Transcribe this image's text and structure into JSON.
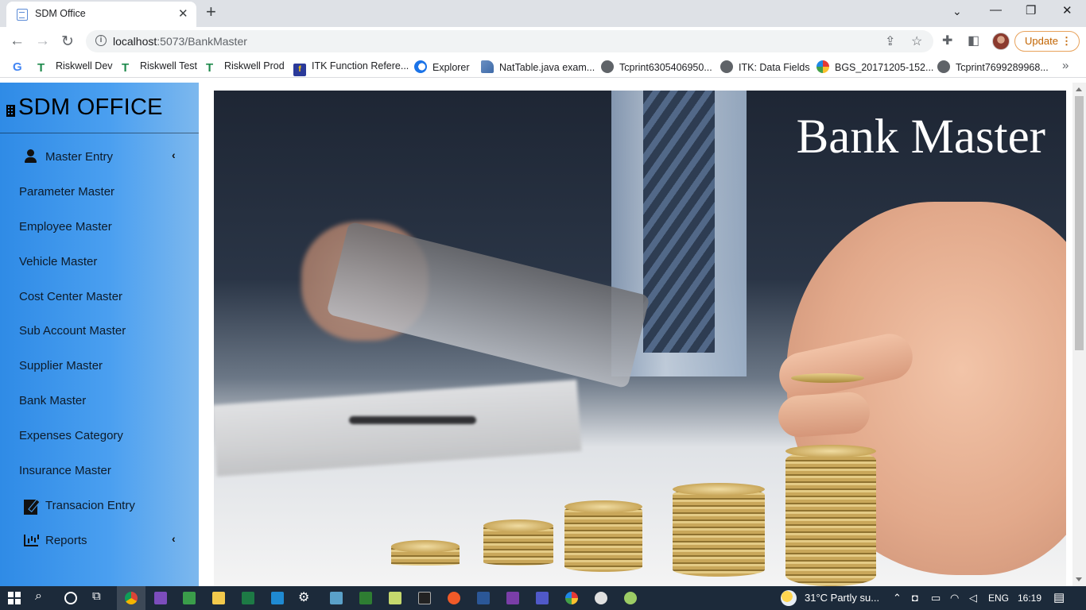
{
  "browser": {
    "tab_title": "SDM Office",
    "tab_close": "✕",
    "new_tab": "+",
    "url_host": "localhost",
    "url_path": ":5073/BankMaster",
    "update_label": "Update",
    "window_controls": {
      "minimize": "—",
      "restore": "❐",
      "close": "✕",
      "tab_search": "⌄"
    }
  },
  "bookmarks": [
    {
      "label": "",
      "icon": "google-icon"
    },
    {
      "label": "Riskwell Dev",
      "icon": "tree-icon"
    },
    {
      "label": "Riskwell Test",
      "icon": "tree-icon"
    },
    {
      "label": "Riskwell Prod",
      "icon": "tree-icon"
    },
    {
      "label": "ITK Function Refere...",
      "icon": "itk-icon"
    },
    {
      "label": "Explorer",
      "icon": "explorer-icon"
    },
    {
      "label": "NatTable.java exam...",
      "icon": "nattable-icon"
    },
    {
      "label": "Tcprint6305406950...",
      "icon": "globe-icon"
    },
    {
      "label": "ITK: Data Fields",
      "icon": "globe-icon"
    },
    {
      "label": "BGS_20171205-152...",
      "icon": "bgs-icon"
    },
    {
      "label": "Tcprint7699289968...",
      "icon": "globe-icon"
    }
  ],
  "sidebar": {
    "brand": "SDM OFFICE",
    "groups": [
      {
        "label": "Master Entry",
        "icon": "user-icon"
      },
      {
        "label": "Transacion Entry",
        "icon": "edit-document-icon"
      },
      {
        "label": "Reports",
        "icon": "bar-chart-icon"
      }
    ],
    "master_items": [
      "Parameter Master",
      "Employee Master",
      "Vehicle Master",
      "Cost Center Master",
      "Sub Account Master",
      "Supplier Master",
      "Bank Master",
      "Expenses Category",
      "Insurance Master"
    ]
  },
  "hero": {
    "title": "Bank Master"
  },
  "taskbar": {
    "weather": "31°C  Partly su...",
    "language": "ENG",
    "time": "16:19"
  },
  "colors": {
    "sidebar_start": "#2f8be6",
    "sidebar_end": "#7db8ee",
    "update_accent": "#c26401",
    "taskbar": "#1c2a3a"
  }
}
